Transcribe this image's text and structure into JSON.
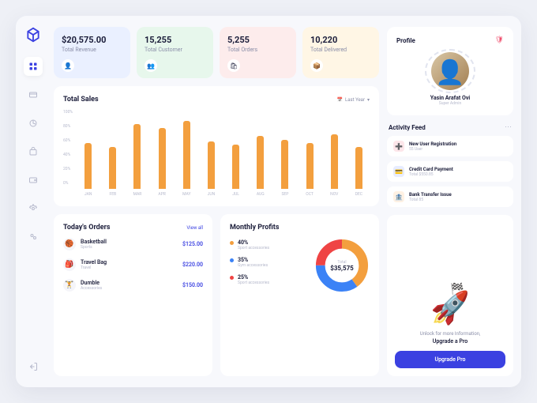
{
  "stats": [
    {
      "value": "$20,575.00",
      "label": "Total Revenue",
      "icon": "👤"
    },
    {
      "value": "15,255",
      "label": "Total Customer",
      "icon": "👥"
    },
    {
      "value": "5,255",
      "label": "Total Orders",
      "icon": "🛍"
    },
    {
      "value": "10,220",
      "label": "Total Delivered",
      "icon": "📦"
    }
  ],
  "sales": {
    "title": "Total Sales",
    "filter": "Last Year"
  },
  "orders": {
    "title": "Today's Orders",
    "viewall": "View all",
    "items": [
      {
        "name": "Basketball",
        "cat": "Sports",
        "price": "$125.00",
        "icon": "🏀"
      },
      {
        "name": "Travel Bag",
        "cat": "Travel",
        "price": "$220.00",
        "icon": "🎒"
      },
      {
        "name": "Dumble",
        "cat": "Accessories",
        "price": "$150.00",
        "icon": "🏋"
      }
    ]
  },
  "profits": {
    "title": "Monthly Profits",
    "center_label": "Total",
    "center_value": "$35,575",
    "items": [
      {
        "pct": "40%",
        "label": "Sport accessories"
      },
      {
        "pct": "35%",
        "label": "Gym accessories"
      },
      {
        "pct": "25%",
        "label": "Sport accessories"
      }
    ]
  },
  "profile": {
    "title": "Profile",
    "name": "Yasin Arafat Ovi",
    "role": "Super Admin"
  },
  "activity": {
    "title": "Activity Feed",
    "items": [
      {
        "t1": "New User Registration",
        "t2": "55 User",
        "icon": "➕"
      },
      {
        "t1": "Credit Card Payment",
        "t2": "Total $550.85",
        "icon": "💳"
      },
      {
        "t1": "Bank Transfer Issue",
        "t2": "Total 85",
        "icon": "🏦"
      }
    ]
  },
  "upgrade": {
    "t1": "Unlock for more Information,",
    "t2": "Upgrade a Pro",
    "btn": "Upgrade Pro"
  },
  "chart_data": {
    "type": "bar",
    "title": "Total Sales",
    "xlabel": "",
    "ylabel": "",
    "ylim": [
      0,
      100
    ],
    "categories": [
      "JAN",
      "FEB",
      "MAR",
      "APR",
      "MAY",
      "JUN",
      "JUL",
      "AUG",
      "SEP",
      "OCT",
      "NOV",
      "DEC"
    ],
    "values": [
      60,
      55,
      85,
      80,
      90,
      62,
      58,
      70,
      65,
      60,
      72,
      55
    ],
    "yticks": [
      "100%",
      "80%",
      "60%",
      "40%",
      "20%",
      "0%"
    ]
  }
}
